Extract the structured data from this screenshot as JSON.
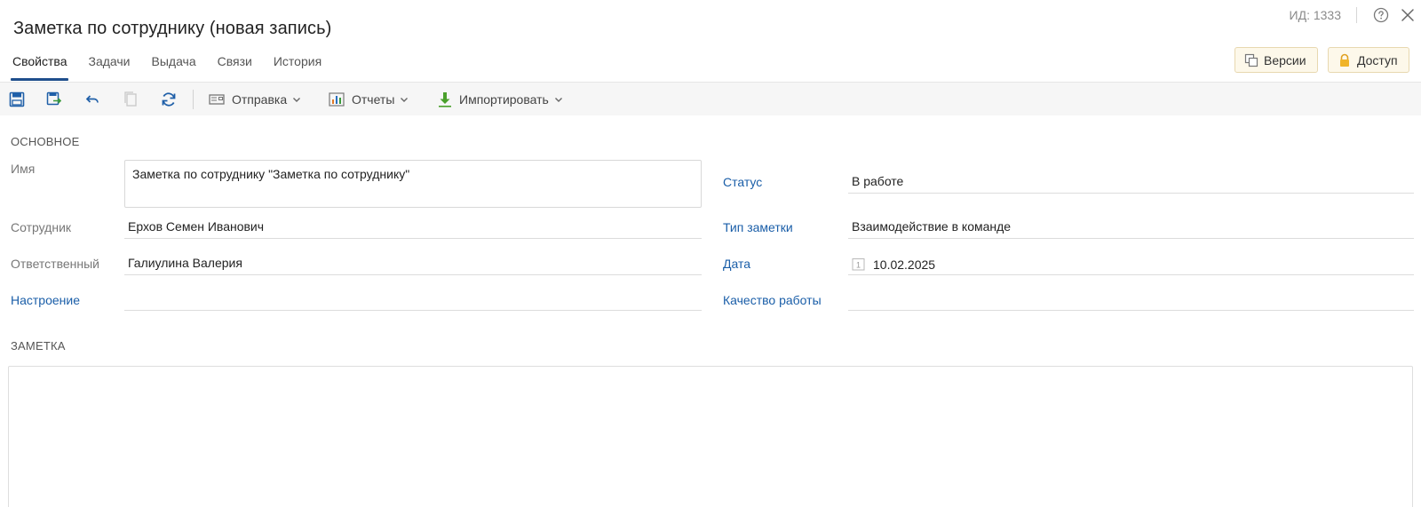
{
  "header": {
    "title": "Заметка по сотруднику (новая запись)",
    "record_id": "ИД: 1333"
  },
  "tabs": [
    {
      "label": "Свойства",
      "active": true
    },
    {
      "label": "Задачи",
      "active": false
    },
    {
      "label": "Выдача",
      "active": false
    },
    {
      "label": "Связи",
      "active": false
    },
    {
      "label": "История",
      "active": false
    }
  ],
  "header_buttons": {
    "versions": "Версии",
    "access": "Доступ"
  },
  "toolbar": {
    "send": "Отправка",
    "reports": "Отчеты",
    "import": "Импортировать"
  },
  "sections": {
    "main": "ОСНОВНОЕ",
    "note": "ЗАМЕТКА"
  },
  "fields": {
    "name": {
      "label": "Имя",
      "value": "Заметка по сотруднику \"Заметка по сотруднику\""
    },
    "employee": {
      "label": "Сотрудник",
      "value": "Ерхов Семен Иванович"
    },
    "responsible": {
      "label": "Ответственный",
      "value": "Галиулина Валерия"
    },
    "mood": {
      "label": "Настроение",
      "value": ""
    },
    "status": {
      "label": "Статус",
      "value": "В работе"
    },
    "note_type": {
      "label": "Тип заметки",
      "value": "Взаимодействие в команде"
    },
    "date": {
      "label": "Дата",
      "value": "10.02.2025"
    },
    "work_quality": {
      "label": "Качество работы",
      "value": ""
    }
  },
  "colors": {
    "accent": "#1f4e8c",
    "link": "#1a5ea8",
    "header_button_bg": "#fdf8ea",
    "toolbar_bg": "#f6f6f6"
  }
}
